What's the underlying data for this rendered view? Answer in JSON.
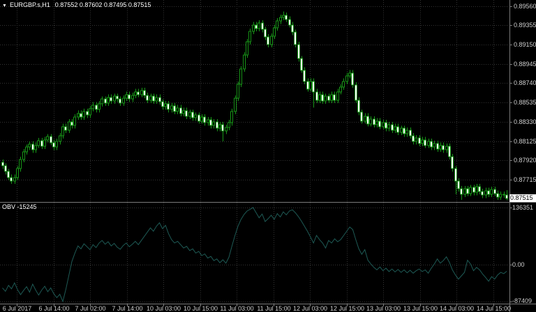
{
  "title": {
    "window_icon": "▼",
    "symbol_period": "EURGBP.s,H1",
    "ohlc": "0.87552 0.87602 0.87495 0.87515"
  },
  "indicator": {
    "label": "OBV",
    "value": "-15245"
  },
  "price_axis": {
    "current": "0.87515"
  },
  "colors": {
    "background": "#000000",
    "grid": "#343434",
    "candle_green": "#179517",
    "bull_fill": "#000000",
    "bear_fill": "#ffffff",
    "obv_line": "#1e5a55",
    "axis_text": "#cfcfcf",
    "separator": "#7a7a7a",
    "price_tag_bg": "#ffffff",
    "price_tag_text": "#000000",
    "title_text": "#ffffff"
  },
  "chart_data": {
    "type": "candlestick_with_indicator",
    "main": {
      "type": "candlestick",
      "symbol": "EURGBP.s",
      "timeframe": "H1",
      "bars": 168,
      "first_open": 0.879,
      "default_wick": 0.0003,
      "closes": [
        0.8786,
        0.878,
        0.8774,
        0.877,
        0.8774,
        0.8783,
        0.8793,
        0.8801,
        0.8806,
        0.8809,
        0.8803,
        0.8808,
        0.8813,
        0.8807,
        0.8814,
        0.8817,
        0.8811,
        0.8806,
        0.8812,
        0.8818,
        0.8828,
        0.8824,
        0.8833,
        0.8829,
        0.8838,
        0.8842,
        0.8838,
        0.8844,
        0.884,
        0.8847,
        0.8851,
        0.8846,
        0.8852,
        0.8857,
        0.8853,
        0.8859,
        0.8855,
        0.886,
        0.8857,
        0.8853,
        0.8858,
        0.8862,
        0.8857,
        0.8861,
        0.8865,
        0.8862,
        0.8866,
        0.8861,
        0.8856,
        0.886,
        0.8855,
        0.8859,
        0.8854,
        0.8849,
        0.8852,
        0.8846,
        0.885,
        0.8844,
        0.8848,
        0.8842,
        0.8845,
        0.8839,
        0.8843,
        0.8837,
        0.884,
        0.8834,
        0.8838,
        0.8832,
        0.8835,
        0.8829,
        0.8833,
        0.8826,
        0.883,
        0.8823,
        0.8827,
        0.8832,
        0.8844,
        0.8858,
        0.8873,
        0.8889,
        0.8904,
        0.8918,
        0.8929,
        0.8936,
        0.8932,
        0.8938,
        0.8931,
        0.8923,
        0.8915,
        0.8924,
        0.8933,
        0.894,
        0.8944,
        0.8946,
        0.8942,
        0.8936,
        0.8928,
        0.8915,
        0.89,
        0.8888,
        0.8876,
        0.8868,
        0.8876,
        0.8865,
        0.8856,
        0.8862,
        0.8855,
        0.886,
        0.8856,
        0.8862,
        0.8856,
        0.8865,
        0.887,
        0.8876,
        0.8882,
        0.8885,
        0.8872,
        0.8856,
        0.8843,
        0.8834,
        0.8839,
        0.8831,
        0.8836,
        0.883,
        0.8834,
        0.8828,
        0.8832,
        0.8826,
        0.883,
        0.8824,
        0.8828,
        0.8822,
        0.8826,
        0.882,
        0.8824,
        0.8818,
        0.8812,
        0.8816,
        0.881,
        0.8814,
        0.8808,
        0.8812,
        0.8806,
        0.881,
        0.8804,
        0.8808,
        0.8803,
        0.8807,
        0.8796,
        0.8783,
        0.877,
        0.8762,
        0.8756,
        0.8762,
        0.8757,
        0.8763,
        0.8758,
        0.8764,
        0.8759,
        0.8755,
        0.876,
        0.8756,
        0.8761,
        0.8757,
        0.8753,
        0.8756,
        0.87552,
        0.87515
      ],
      "special_wicks": {
        "3": {
          "low": 0.8767
        },
        "46": {
          "high": 0.8869
        },
        "73": {
          "low": 0.8812
        },
        "93": {
          "high": 0.895
        },
        "103": {
          "low": 0.8848
        },
        "115": {
          "high": 0.8888
        },
        "150": {
          "low": 0.8756
        },
        "152": {
          "low": 0.875
        },
        "167": {
          "high": 0.87602,
          "low": 0.87495
        }
      },
      "last_bar": {
        "open": 0.87552,
        "high": 0.87602,
        "low": 0.87495,
        "close": 0.87515
      },
      "current_price": 0.87515,
      "y_tick_labels": [
        "0.89560",
        "0.89355",
        "0.89150",
        "0.88945",
        "0.88740",
        "0.88535",
        "0.88330",
        "0.88125",
        "0.87920",
        "0.87715"
      ]
    },
    "indicator": {
      "type": "line",
      "name": "OBV",
      "max": 136351,
      "min": -87409,
      "last": -15245,
      "axis_labels": {
        "top": "136351",
        "zero": "0.00",
        "bottom": "-87409"
      },
      "values": [
        -55000,
        -63000,
        -49000,
        -57000,
        -43000,
        -59000,
        -71000,
        -61000,
        -52000,
        -65000,
        -46000,
        -60000,
        -72000,
        -60000,
        -51000,
        -64000,
        -55000,
        -69000,
        -78000,
        -70000,
        -87409,
        -58000,
        -25000,
        8000,
        28000,
        45000,
        38000,
        50000,
        43000,
        36000,
        48000,
        41000,
        52000,
        58000,
        49000,
        55000,
        45000,
        51000,
        42000,
        37000,
        46000,
        52000,
        43000,
        49000,
        56000,
        48000,
        58000,
        68000,
        78000,
        88000,
        80000,
        92000,
        100000,
        86000,
        94000,
        74000,
        60000,
        52000,
        56000,
        48000,
        40000,
        44000,
        34000,
        38000,
        28000,
        32000,
        22000,
        26000,
        16000,
        20000,
        10000,
        14000,
        5000,
        12000,
        4000,
        18000,
        45000,
        70000,
        92000,
        108000,
        120000,
        128000,
        132000,
        136351,
        124000,
        112000,
        121000,
        103000,
        110000,
        118000,
        108000,
        122000,
        114000,
        126000,
        119000,
        128000,
        131000,
        124000,
        115000,
        104000,
        92000,
        80000,
        66000,
        52000,
        70000,
        60000,
        52000,
        40000,
        58000,
        52000,
        62000,
        55000,
        60000,
        70000,
        80000,
        90000,
        84000,
        60000,
        38000,
        25000,
        36000,
        11000,
        2000,
        -6000,
        -12000,
        -5000,
        -14000,
        -8000,
        -16000,
        -10000,
        -17000,
        -11000,
        -18000,
        -12000,
        -19000,
        -13000,
        -20000,
        -14000,
        -10000,
        -16000,
        -12000,
        -20000,
        -8000,
        2000,
        14000,
        4000,
        10000,
        19000,
        6000,
        -12000,
        -24000,
        -34000,
        -26000,
        -18000,
        11000,
        2000,
        -14000,
        -6000,
        -12000,
        -22000,
        -30000,
        -39000,
        -28000,
        -34000,
        -24000,
        -18000,
        -21000,
        -15245
      ]
    },
    "x_tick_labels": [
      "6 Jul 2017",
      "6 Jul 14:00",
      "7 Jul 02:00",
      "7 Jul 14:00",
      "10 Jul 03:00",
      "10 Jul 15:00",
      "11 Jul 03:00",
      "11 Jul 15:00",
      "12 Jul 03:00",
      "12 Jul 15:00",
      "13 Jul 03:00",
      "13 Jul 15:00",
      "14 Jul 03:00",
      "14 Jul 15:00"
    ]
  }
}
